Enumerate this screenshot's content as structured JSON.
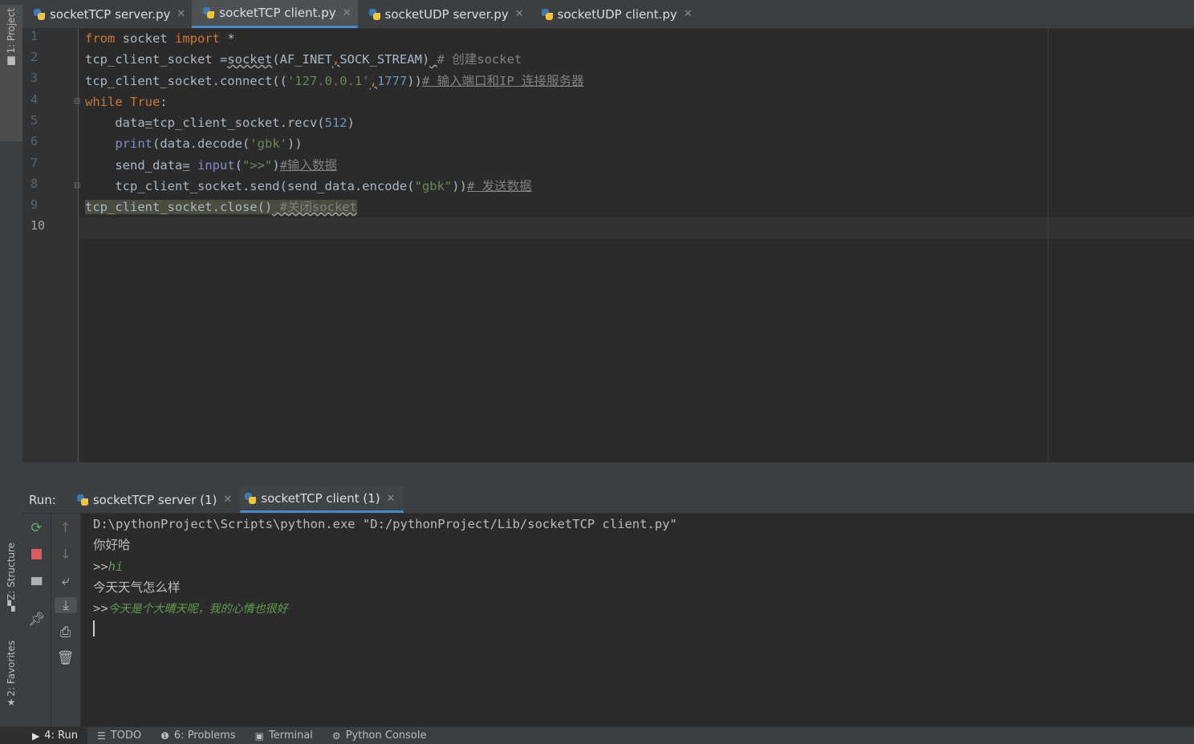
{
  "colors": {
    "keyword": "#cc7832",
    "builtin": "#8888c6",
    "string": "#6a8759",
    "number": "#6897bb",
    "comment": "#808080",
    "user_input": "#5ca04f",
    "accent": "#4a88c7"
  },
  "side_tabs": {
    "project": "1: Project",
    "structure": "Z: Structure",
    "favorites": "2: Favorites"
  },
  "editor_tabs": [
    {
      "label": "socketTCP server.py",
      "active": false
    },
    {
      "label": "socketTCP client.py",
      "active": true
    },
    {
      "label": "socketUDP server.py",
      "active": false
    },
    {
      "label": "socketUDP client.py",
      "active": false
    }
  ],
  "editor": {
    "line_numbers": [
      "1",
      "2",
      "3",
      "4",
      "5",
      "6",
      "7",
      "8",
      "9",
      "10"
    ],
    "current_line": "10",
    "code": {
      "l1": {
        "t1": "from",
        "t2": " socket ",
        "t3": "import",
        "t4": " *"
      },
      "l2": {
        "t1": "tcp_client_socket =",
        "t2": "socket",
        "t3": "(AF_INET",
        "t4": ",",
        "t5": "SOCK_STREAM)",
        "t6": " ",
        "t7": "# 创建socket"
      },
      "l3": {
        "t1": "tcp_client_socket.connect((",
        "t2": "'127.0.0.1'",
        "t3": ",",
        "t4": "1777",
        "t5": "))",
        "t6": "# 输入端口和IP 连接服务器"
      },
      "l4": {
        "t1": "while",
        "t2": " ",
        "t3": "True",
        "t4": ":"
      },
      "l5": {
        "t1": "    data",
        "t2": "=",
        "t3": "tcp_client_socket.recv(",
        "t4": "512",
        "t5": ")"
      },
      "l6": {
        "t1": "    ",
        "t2": "print",
        "t3": "(data.decode(",
        "t4": "'gbk'",
        "t5": "))"
      },
      "l7": {
        "t1": "    send_data",
        "t2": "=",
        "t3": " ",
        "t4": "input",
        "t5": "(",
        "t6": "\">>\"",
        "t7": ")",
        "t8": "#输入数据"
      },
      "l8": {
        "t1": "    tcp_client_socket.send(send_data.encode(",
        "t2": "\"gbk\"",
        "t3": "))",
        "t4": "# 发送数据"
      },
      "l9": {
        "t1": "tcp_client_socket.close()",
        "t2": " ",
        "t3": "#关闭socket"
      }
    }
  },
  "run_panel": {
    "label": "Run:",
    "tabs": [
      {
        "label": "socketTCP server (1)",
        "active": false
      },
      {
        "label": "socketTCP client (1)",
        "active": true
      }
    ],
    "console": {
      "command": "D:\\pythonProject\\Scripts\\python.exe \"D:/pythonProject/Lib/socketTCP client.py\"",
      "recv1": "你好哈",
      "prompt1": ">>",
      "input1": "hi",
      "recv2": "今天天气怎么样",
      "prompt2": ">>",
      "input2": "今天是个大晴天呢，我的心情也很好"
    }
  },
  "bottom_bar": [
    {
      "label": "4: Run",
      "icon": "play-icon",
      "active": true
    },
    {
      "label": "TODO",
      "icon": "list-icon"
    },
    {
      "label": "6: Problems",
      "icon": "problems-icon"
    },
    {
      "label": "Terminal",
      "icon": "terminal-icon"
    },
    {
      "label": "Python Console",
      "icon": "python-icon"
    }
  ]
}
